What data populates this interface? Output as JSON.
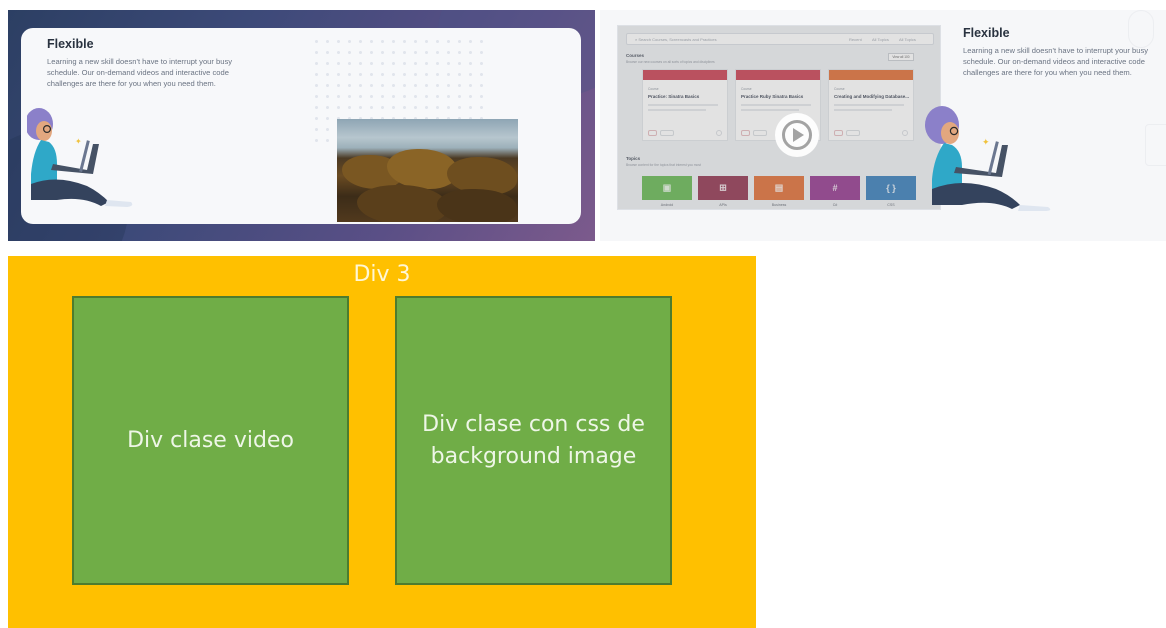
{
  "left_screenshot": {
    "heading": "Flexible",
    "body": "Learning a new skill doesn't have to interrupt your busy schedule. Our on-demand videos and interactive code challenges are there for you when you need them."
  },
  "right_screenshot": {
    "heading": "Flexible",
    "body": "Learning a new skill doesn't have to interrupt your busy schedule. Our on-demand videos and interactive code challenges are there for you when you need them.",
    "app": {
      "search_placeholder": "Search Courses, Screencasts and Practices",
      "filters": [
        "Recent",
        "All Topics",
        "All Topics"
      ],
      "courses_heading": "Courses",
      "courses_sub": "Browse our new courses on all sorts of topics and disciplines",
      "view_all": "View all 100",
      "course_cards": [
        {
          "kind": "Course",
          "title": "Practice: Sinatra Basics",
          "color": "#c8364a"
        },
        {
          "kind": "Course",
          "title": "Practice Ruby Sinatra Basics",
          "color": "#c8364a"
        },
        {
          "kind": "Course",
          "title": "Creating and Modifying Database...",
          "color": "#e0672b"
        }
      ],
      "topics_heading": "Topics",
      "topics_sub": "Browse content for the topics that interest you most",
      "topics": [
        {
          "label": "Android",
          "color": "#5fb54a",
          "glyph": "▣"
        },
        {
          "label": "APIs",
          "color": "#8d2a47",
          "glyph": "⊞"
        },
        {
          "label": "Business",
          "color": "#e0672b",
          "glyph": "▤"
        },
        {
          "label": "C#",
          "color": "#8f2e8a",
          "glyph": "#"
        },
        {
          "label": "CSS",
          "color": "#2f78b8",
          "glyph": "{ }"
        }
      ]
    }
  },
  "diagram": {
    "title": "Div 3",
    "box_left": "Div clase video",
    "box_right": "Div clase con css de background image"
  },
  "colors": {
    "yellow": "#ffc000",
    "green": "#70ad47",
    "navy": "#2c3f63"
  },
  "icons": [
    "play-icon",
    "search-icon",
    "woman-laptop-illustration"
  ]
}
